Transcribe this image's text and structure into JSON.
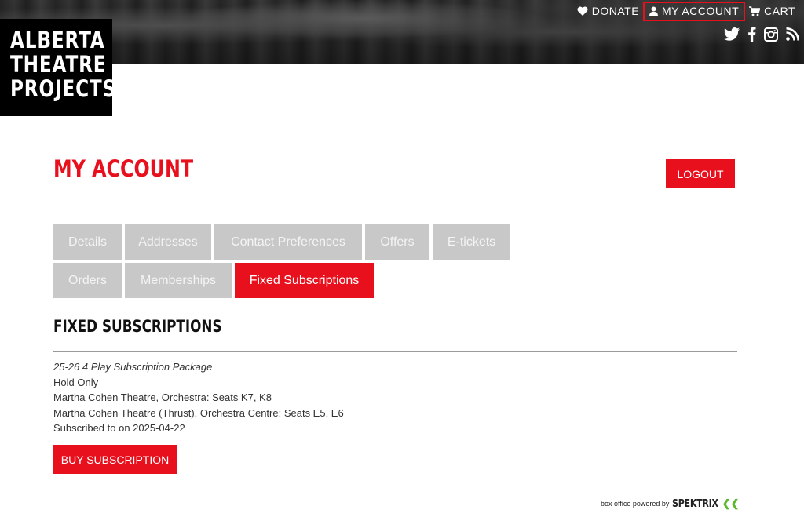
{
  "header": {
    "logo_lines": [
      "ALBERTA",
      "THEATRE",
      "PROJECTS"
    ],
    "nav": [
      {
        "label": "DONATE",
        "icon": "heart-icon"
      },
      {
        "label": "MY ACCOUNT",
        "icon": "user-icon"
      },
      {
        "label": "CART",
        "icon": "cart-icon"
      }
    ],
    "social": [
      "twitter-icon",
      "facebook-icon",
      "instagram-icon",
      "rss-icon"
    ]
  },
  "account": {
    "title": "MY ACCOUNT",
    "logout_label": "LOGOUT"
  },
  "tabs": [
    {
      "label": "Details"
    },
    {
      "label": "Addresses"
    },
    {
      "label": "Contact Preferences"
    },
    {
      "label": "Offers"
    },
    {
      "label": "E-tickets"
    },
    {
      "label": "Orders"
    },
    {
      "label": "Memberships"
    },
    {
      "label": "Fixed Subscriptions"
    }
  ],
  "subscriptions": {
    "title": "FIXED SUBSCRIPTIONS",
    "package": "25-26 4 Play Subscription Package",
    "status": "Hold Only",
    "seats_1": "Martha Cohen Theatre, Orchestra: Seats K7, K8",
    "seats_2": "Martha Cohen Theatre (Thrust), Orchestra Centre: Seats E5, E6",
    "subscribed": "Subscribed to on 2025-04-22",
    "buy_label": "BUY SUBSCRIPTION"
  },
  "footer": {
    "powered_by": "box office powered by",
    "brand": "SPEKTRIX"
  },
  "colors": {
    "accent": "#e8101d",
    "tab_inactive": "#c8c8c8",
    "spektrix_green": "#5cb82e"
  }
}
